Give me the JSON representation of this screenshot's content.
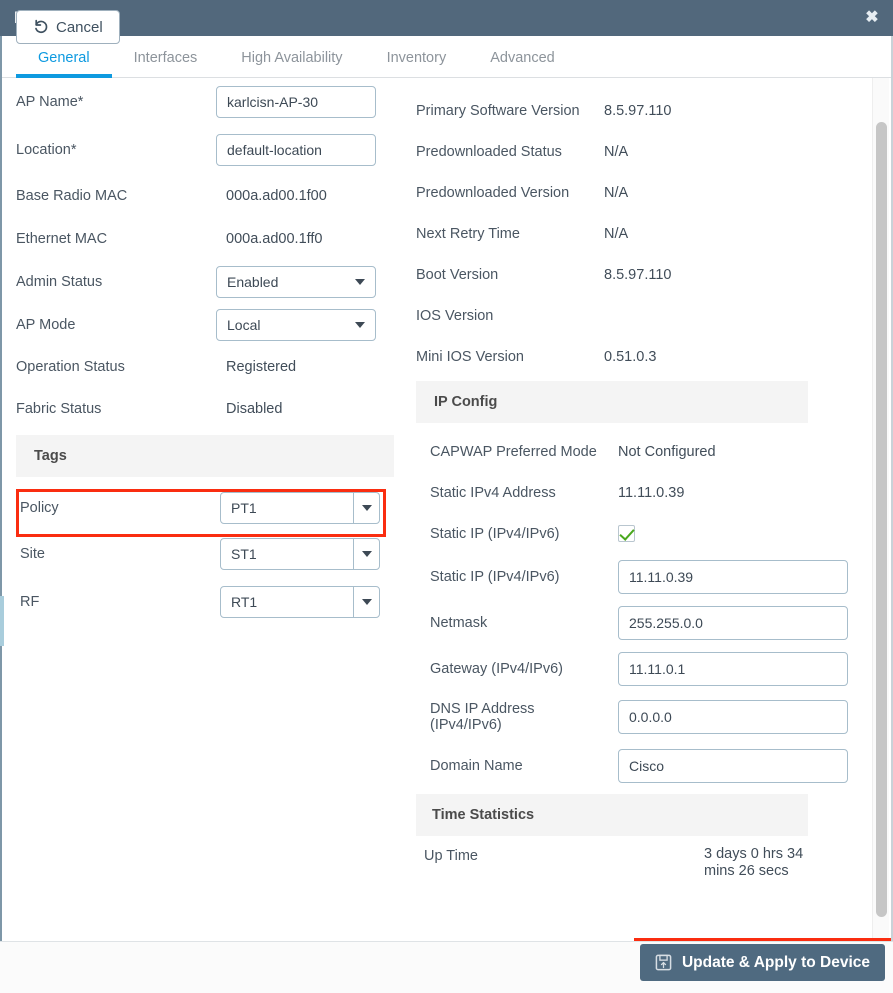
{
  "window": {
    "title": "Edit AP",
    "close_icon": "close-icon"
  },
  "tabs": [
    {
      "label": "General",
      "active": true
    },
    {
      "label": "Interfaces",
      "active": false
    },
    {
      "label": "High Availability",
      "active": false
    },
    {
      "label": "Inventory",
      "active": false
    },
    {
      "label": "Advanced",
      "active": false
    }
  ],
  "left_column": {
    "ap_name": {
      "label": "AP Name*",
      "value": "karlcisn-AP-30"
    },
    "location": {
      "label": "Location*",
      "value": "default-location"
    },
    "base_radio_mac": {
      "label": "Base Radio MAC",
      "value": "000a.ad00.1f00"
    },
    "ethernet_mac": {
      "label": "Ethernet MAC",
      "value": "000a.ad00.1ff0"
    },
    "admin_status": {
      "label": "Admin Status",
      "value": "Enabled"
    },
    "ap_mode": {
      "label": "AP Mode",
      "value": "Local"
    },
    "operation_status": {
      "label": "Operation Status",
      "value": "Registered"
    },
    "fabric_status": {
      "label": "Fabric Status",
      "value": "Disabled"
    },
    "tags_section": {
      "title": "Tags"
    },
    "policy": {
      "label": "Policy",
      "value": "PT1"
    },
    "site": {
      "label": "Site",
      "value": "ST1"
    },
    "rf": {
      "label": "RF",
      "value": "RT1"
    }
  },
  "right_column": {
    "primary_software_version": {
      "label": "Primary Software Version",
      "value": "8.5.97.110"
    },
    "predownloaded_status": {
      "label": "Predownloaded Status",
      "value": "N/A"
    },
    "predownloaded_version": {
      "label": "Predownloaded Version",
      "value": "N/A"
    },
    "next_retry_time": {
      "label": "Next Retry Time",
      "value": "N/A"
    },
    "boot_version": {
      "label": "Boot Version",
      "value": "8.5.97.110"
    },
    "ios_version": {
      "label": "IOS Version",
      "value": ""
    },
    "mini_ios_version": {
      "label": "Mini IOS Version",
      "value": "0.51.0.3"
    },
    "ip_config_section": {
      "title": "IP Config"
    },
    "capwap_preferred_mode": {
      "label": "CAPWAP Preferred Mode",
      "value": "Not Configured"
    },
    "static_ipv4_address": {
      "label": "Static IPv4 Address",
      "value": "11.11.0.39"
    },
    "static_ip_checkbox": {
      "label": "Static IP (IPv4/IPv6)",
      "checked": true
    },
    "static_ip": {
      "label": "Static IP (IPv4/IPv6)",
      "value": "11.11.0.39"
    },
    "netmask": {
      "label": "Netmask",
      "value": "255.255.0.0"
    },
    "gateway": {
      "label": "Gateway (IPv4/IPv6)",
      "value": "11.11.0.1"
    },
    "dns_ip_address": {
      "label_line1": "DNS IP Address",
      "label_line2": "(IPv4/IPv6)",
      "value": "0.0.0.0"
    },
    "domain_name": {
      "label": "Domain Name",
      "value": "Cisco"
    },
    "time_statistics_section": {
      "title": "Time Statistics"
    },
    "up_time": {
      "label": "Up Time",
      "value_line1": "3 days 0 hrs 34",
      "value_line2": "mins 26 secs"
    }
  },
  "footer": {
    "cancel_label": "Cancel",
    "cancel_icon": "undo-arrow-icon",
    "update_label": "Update & Apply to Device",
    "update_icon": "save-floppy-icon"
  },
  "colors": {
    "titlebar": "#52687c",
    "accent_active_tab": "#0e9ae0",
    "highlight_box": "#fa2d10",
    "primary_button": "#4f6a80",
    "checkbox_check": "#4aa81e",
    "section_band": "#f4f4f4"
  }
}
